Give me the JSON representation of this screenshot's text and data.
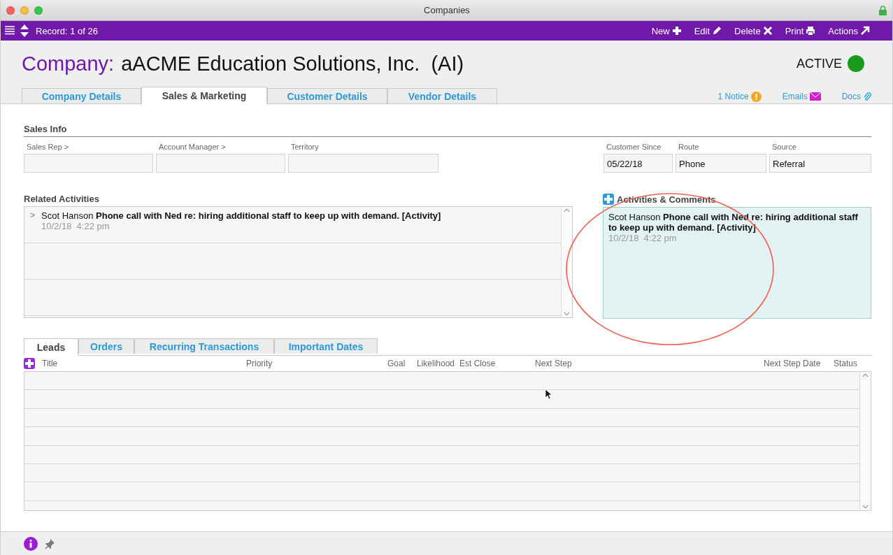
{
  "window": {
    "title": "Companies"
  },
  "toolbar": {
    "record": "Record: 1 of 26",
    "actions": [
      {
        "kind": "new",
        "label": "New"
      },
      {
        "kind": "edit",
        "label": "Edit"
      },
      {
        "kind": "delete",
        "label": "Delete"
      },
      {
        "kind": "print",
        "label": "Print"
      },
      {
        "kind": "actions",
        "label": "Actions"
      }
    ]
  },
  "header": {
    "prefix": "Company:",
    "name": "aACME Education Solutions, Inc.  (AI)",
    "status": "ACTIVE"
  },
  "tabs": [
    {
      "label": "Company Details",
      "selected": false
    },
    {
      "label": "Sales & Marketing",
      "selected": true
    },
    {
      "label": "Customer Details",
      "selected": false
    },
    {
      "label": "Vendor Details",
      "selected": false
    }
  ],
  "links": [
    {
      "kind": "notice",
      "label": "1 Notice"
    },
    {
      "kind": "emails",
      "label": "Emails"
    },
    {
      "kind": "docs",
      "label": "Docs"
    }
  ],
  "sales_info": {
    "title": "Sales Info",
    "left_fields": [
      {
        "label": "Sales Rep >"
      },
      {
        "label": "Account Manager >"
      },
      {
        "label": "Territory"
      }
    ],
    "right_fields": [
      {
        "label": "Customer Since",
        "value": "05/22/18"
      },
      {
        "label": "Route",
        "value": "Phone"
      },
      {
        "label": "Source",
        "value": "Referral"
      }
    ]
  },
  "related_activities": {
    "title": "Related Activities",
    "items": [
      {
        "expander": ">",
        "text": "Scot Hanson **Phone call with Ned re: hiring additional staff to keep up with demand. [Activity]**",
        "date": "10/2/18  4:22 pm"
      }
    ]
  },
  "comments": {
    "title": "Activities & Comments",
    "items": [
      {
        "text": "Scot Hanson **Phone call with Ned re: hiring additional staff to keep up with demand. [Activity]**",
        "date": "10/2/18  4:22 pm"
      }
    ]
  },
  "lower_tabs": [
    {
      "label": "Leads",
      "selected": true
    },
    {
      "label": "Orders",
      "selected": false
    },
    {
      "label": "Recurring Transactions",
      "selected": false
    },
    {
      "label": "Important Dates",
      "selected": false
    }
  ],
  "leads_table": {
    "columns": [
      "Title",
      "Priority",
      "Goal",
      "Likelihood",
      "Est Close",
      "Next Step",
      "Next Step Date",
      "Status"
    ]
  }
}
